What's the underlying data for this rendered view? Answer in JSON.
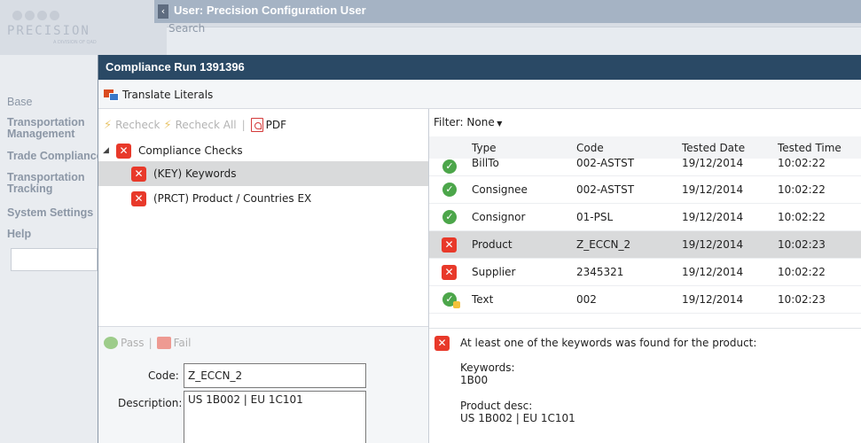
{
  "app": {
    "logo_text": "PRECISION",
    "logo_subtext": "A DIVISION OF QAD",
    "window_title": "User: Precision Configuration User",
    "search_label": "Search",
    "nav_items": [
      "Base",
      "Transportation Management",
      "Trade Compliance",
      "Transportation Tracking",
      "System Settings",
      "Help"
    ]
  },
  "dialog": {
    "title": "Compliance Run 1391396",
    "translate_label": "Translate Literals",
    "left_toolbar": {
      "recheck": "Recheck",
      "recheck_all": "Recheck All",
      "pdf": "PDF"
    },
    "tree": {
      "root_label": "Compliance Checks",
      "children": [
        {
          "label": "(KEY) Keywords",
          "status": "fail",
          "selected": true
        },
        {
          "label": "(PRCT) Product / Countries EX",
          "status": "fail",
          "selected": false
        }
      ]
    },
    "detail": {
      "pass_label": "Pass",
      "fail_label": "Fail",
      "code_label": "Code:",
      "code_value": "Z_ECCN_2",
      "description_label": "Description:",
      "description_value": "US 1B002 | EU 1C101"
    },
    "filter": {
      "label": "Filter:",
      "value": "None"
    },
    "grid": {
      "headers": [
        "Type",
        "Code",
        "Tested Date",
        "Tested Time"
      ],
      "rows": [
        {
          "status": "pass",
          "type": "BillTo",
          "code": "002-ASTST",
          "date": "19/12/2014",
          "time": "10:02:22"
        },
        {
          "status": "pass",
          "type": "Consignee",
          "code": "002-ASTST",
          "date": "19/12/2014",
          "time": "10:02:22"
        },
        {
          "status": "pass",
          "type": "Consignor",
          "code": "01-PSL",
          "date": "19/12/2014",
          "time": "10:02:22"
        },
        {
          "status": "fail",
          "type": "Product",
          "code": "Z_ECCN_2",
          "date": "19/12/2014",
          "time": "10:02:23",
          "selected": true
        },
        {
          "status": "fail",
          "type": "Supplier",
          "code": "2345321",
          "date": "19/12/2014",
          "time": "10:02:22"
        },
        {
          "status": "pass-override",
          "type": "Text",
          "code": "002",
          "date": "19/12/2014",
          "time": "10:02:23"
        }
      ]
    },
    "message": {
      "text": "At least one of the keywords was found for the product:",
      "keywords_label": "Keywords:",
      "keywords_value": "1B00",
      "product_desc_label": "Product desc:",
      "product_desc_value": "US 1B002 | EU 1C101"
    }
  },
  "colors": {
    "dialog_title_bg": "#2a4965",
    "fail_red": "#e8392a",
    "pass_green": "#4ca64a",
    "selected_row": "#d9dadb"
  }
}
